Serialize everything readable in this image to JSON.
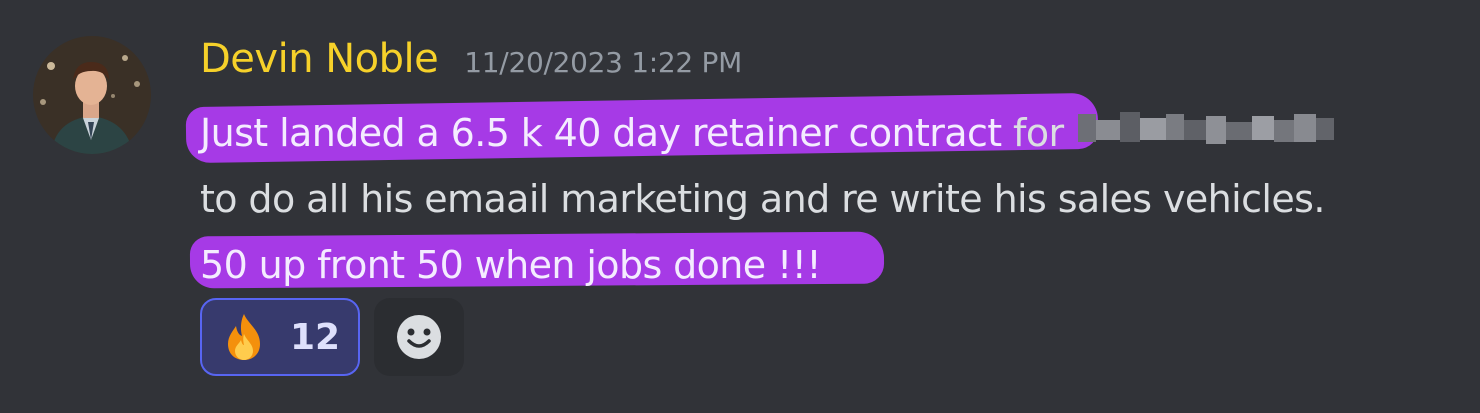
{
  "message": {
    "author": "Devin Noble",
    "timestamp": "11/20/2023 1:22 PM",
    "lines": {
      "line1_highlighted": "Just landed a 6.5 k 40 day retainer contract",
      "line1_rest": " for",
      "line2": "to do all his emaail marketing and re write his sales vehicles.",
      "line3_highlighted": "50 up front 50 when jobs done !!!"
    },
    "highlight_color": "#a63ae6",
    "author_color": "#f6d12a"
  },
  "reactions": [
    {
      "emoji": "fire-icon",
      "count": "12",
      "selected": true
    }
  ],
  "add_reaction": {
    "icon": "smiley-icon"
  },
  "colors": {
    "background": "#313338",
    "text": "#dbdee1",
    "timestamp": "#949ba4",
    "reaction_border": "#5865f2"
  }
}
